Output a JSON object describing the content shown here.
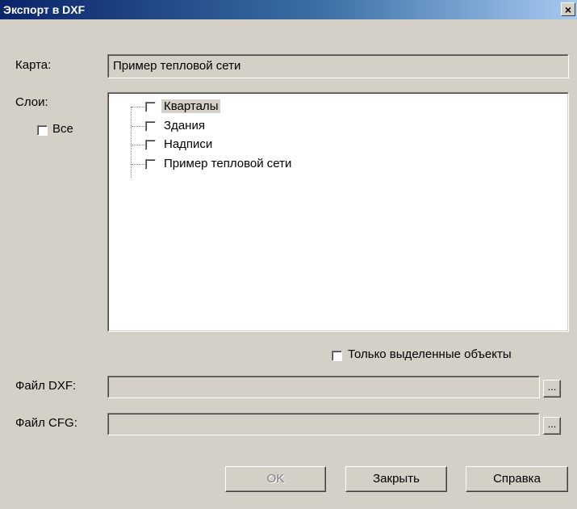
{
  "window": {
    "title": "Экспорт в DXF",
    "close_glyph": "×"
  },
  "map": {
    "label": "Карта:",
    "value": "Пример тепловой сети"
  },
  "layers": {
    "label": "Слои:",
    "all_label": "Все",
    "all_checked": false,
    "items": [
      {
        "label": "Кварталы",
        "checked": false,
        "selected": true
      },
      {
        "label": "Здания",
        "checked": false,
        "selected": false
      },
      {
        "label": "Надписи",
        "checked": false,
        "selected": false
      },
      {
        "label": "Пример тепловой сети",
        "checked": false,
        "selected": false
      }
    ]
  },
  "only_selected": {
    "label": "Только выделенные объекты",
    "checked": false
  },
  "dxf_file": {
    "label": "Файл DXF:",
    "value": "",
    "browse_label": "..."
  },
  "cfg_file": {
    "label": "Файл CFG:",
    "value": "",
    "browse_label": "..."
  },
  "buttons": {
    "ok": "OK",
    "close": "Закрыть",
    "help": "Справка"
  },
  "icons": {
    "close": "close-icon"
  }
}
